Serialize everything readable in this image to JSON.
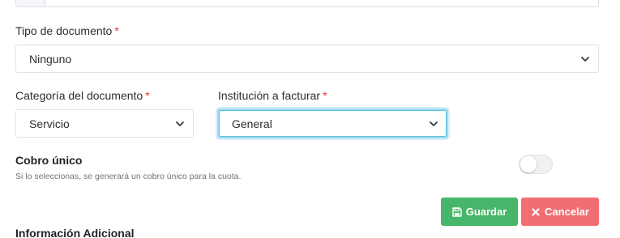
{
  "tipo_documento": {
    "label": "Tipo de documento",
    "required_mark": "*",
    "selected": "Ninguno"
  },
  "categoria_documento": {
    "label": "Categoría del documento",
    "required_mark": "*",
    "selected": "Servicio"
  },
  "institucion_facturar": {
    "label": "Institución a facturar",
    "required_mark": "*",
    "selected": "General"
  },
  "cobro_unico": {
    "title": "Cobro único",
    "help": "Si lo seleccionas, se generará un cobro único para la cuota.",
    "enabled": false
  },
  "actions": {
    "save_label": "Guardar",
    "cancel_label": "Cancelar"
  },
  "info_adicional": {
    "title": "Información Adicional"
  },
  "colors": {
    "save": "#48b66a",
    "cancel": "#f16f73",
    "required": "#e3342f",
    "focus": "#5bc3e0"
  }
}
